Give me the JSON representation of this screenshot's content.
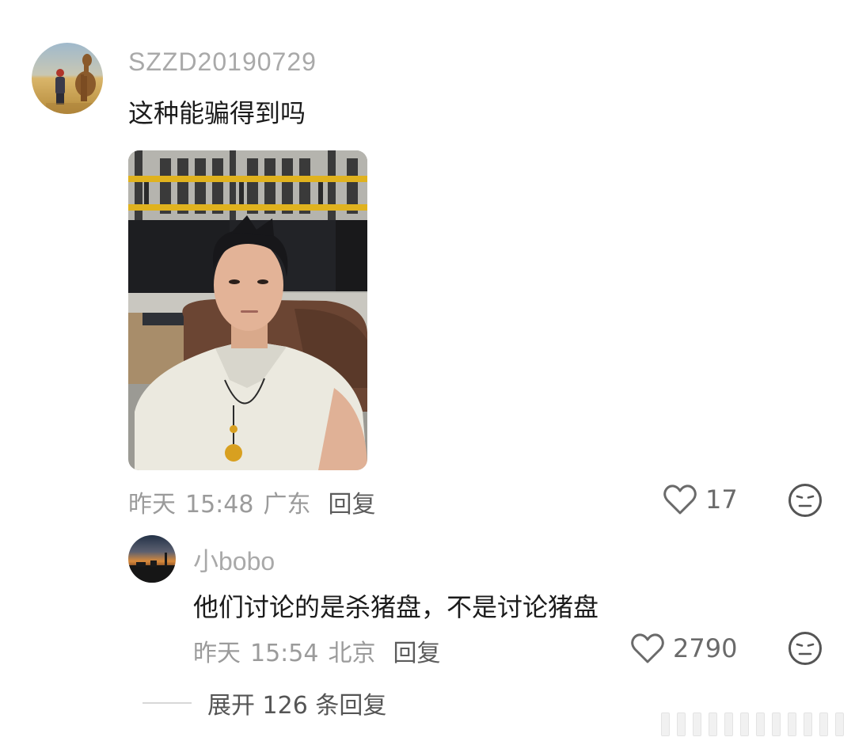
{
  "main_comment": {
    "username": "SZZD20190729",
    "text": "这种能骗得到吗",
    "meta": {
      "day": "昨天",
      "time": "15:48",
      "location": "广东",
      "reply_label": "回复"
    },
    "likes": "17",
    "avatar_icon": "camel-desert-avatar",
    "image_icon": "selfie-photo"
  },
  "reply_comment": {
    "username": "小bobo",
    "text": "他们讨论的是杀猪盘，不是讨论猪盘",
    "meta": {
      "day": "昨天",
      "time": "15:54",
      "location": "北京",
      "reply_label": "回复"
    },
    "likes": "2790",
    "avatar_icon": "sunset-skyline-avatar"
  },
  "expand_replies": {
    "label": "展开 126 条回复"
  },
  "icons": {
    "like": "heart-outline-icon",
    "emoji": "neutral-face-icon"
  },
  "colors": {
    "username": "#a9a9a9",
    "text": "#1b1b1b",
    "meta": "#9b9b9b",
    "reply": "#5c5c5c"
  }
}
